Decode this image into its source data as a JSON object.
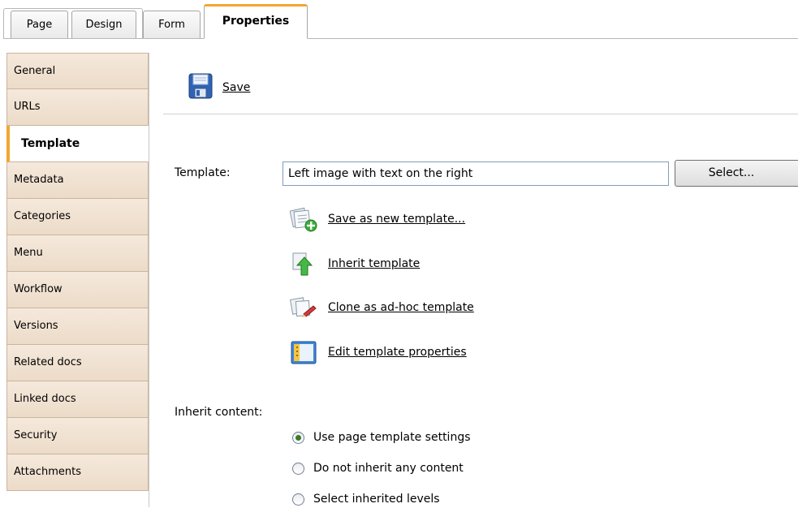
{
  "tabs": [
    {
      "label": "Page"
    },
    {
      "label": "Design"
    },
    {
      "label": "Form"
    },
    {
      "label": "Properties",
      "active": true
    }
  ],
  "sidebar": {
    "items": [
      {
        "label": "General"
      },
      {
        "label": "URLs"
      },
      {
        "label": "Template",
        "active": true
      },
      {
        "label": "Metadata"
      },
      {
        "label": "Categories"
      },
      {
        "label": "Menu"
      },
      {
        "label": "Workflow"
      },
      {
        "label": "Versions"
      },
      {
        "label": "Related docs"
      },
      {
        "label": "Linked docs"
      },
      {
        "label": "Security"
      },
      {
        "label": "Attachments"
      }
    ]
  },
  "toolbar": {
    "save_label": "Save",
    "save_icon": "floppy-disk-icon"
  },
  "form": {
    "template_label": "Template:",
    "template_value": "Left image with text on the right",
    "select_label": "Select...",
    "actions": [
      {
        "label": "Save as new template...",
        "icon": "save-template-icon"
      },
      {
        "label": "Inherit template",
        "icon": "inherit-arrow-icon"
      },
      {
        "label": "Clone as ad-hoc template",
        "icon": "clone-template-icon"
      },
      {
        "label": "Edit template properties",
        "icon": "edit-properties-icon"
      }
    ],
    "inherit_content_label": "Inherit content:",
    "inherit_options": [
      {
        "label": "Use page template settings",
        "checked": true
      },
      {
        "label": "Do not inherit any content",
        "checked": false
      },
      {
        "label": "Select inherited levels",
        "checked": false
      }
    ]
  },
  "colors": {
    "accent": "#f4a532",
    "nav_bg": "#efe0cf",
    "input_border": "#7f9db9"
  }
}
